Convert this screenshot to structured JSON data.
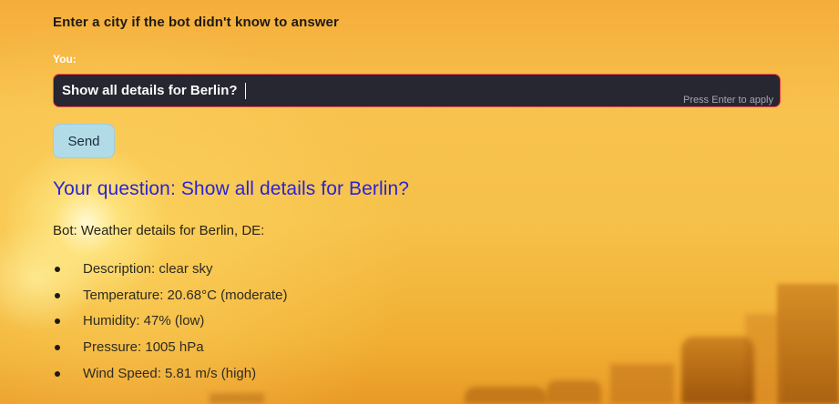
{
  "instruction": "Enter a city if the bot didn't know to answer",
  "input": {
    "label": "You:",
    "value": "Show all details for Berlin?",
    "hint": "Press Enter to apply"
  },
  "send_label": "Send",
  "question": "Your question: Show all details for Berlin?",
  "bot_line": "Bot: Weather details for Berlin, DE:",
  "details": [
    "Description: clear sky",
    "Temperature: 20.68°C (moderate)",
    "Humidity: 47% (low)",
    "Pressure: 1005 hPa",
    "Wind Speed: 5.81 m/s (high)"
  ],
  "colors": {
    "accent_border": "#ff4b4b",
    "input_bg": "#262730",
    "question_text": "#2a24d6",
    "button_bg": "#b2dbe8"
  }
}
